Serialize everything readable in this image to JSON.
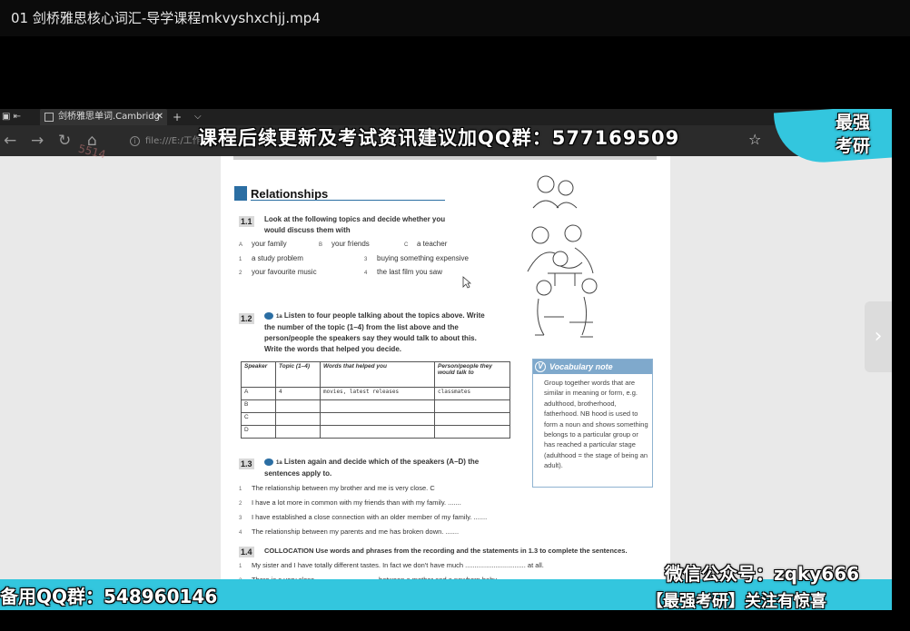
{
  "window": {
    "title": "01 剑桥雅思核心词汇-导学课程mkvyshxchjj.mp4"
  },
  "browser": {
    "tab_title": "剑桥雅思单词.Cambridg",
    "tab_close": "✕",
    "new_tab": "+",
    "tab_menu": "⌵",
    "address": "file:///E:/工作/",
    "watermark": "5514"
  },
  "overlay": {
    "top_banner": "课程后续更新及考试资讯建议加QQ群：577169509",
    "logo": "最强考研",
    "bottom_left": "备用QQ群：548960146",
    "wechat": "微信公众号：zqky666",
    "slogan": "【最强考研】关注有惊喜"
  },
  "page": {
    "section_title": "Relationships",
    "ex11": {
      "num": "1.1",
      "instruction": "Look at the following topics and decide whether you would discuss them with",
      "options_top": [
        {
          "key": "A",
          "text": "your family"
        },
        {
          "key": "B",
          "text": "your friends"
        },
        {
          "key": "C",
          "text": "a teacher"
        }
      ],
      "options": [
        {
          "key": "1",
          "text": "a study problem"
        },
        {
          "key": "3",
          "text": "buying something expensive"
        },
        {
          "key": "2",
          "text": "your favourite music"
        },
        {
          "key": "4",
          "text": "the last film you saw"
        }
      ]
    },
    "ex12": {
      "num": "1.2",
      "track": "1a",
      "instruction": "Listen to four people talking about the topics above. Write the number of the topic (1–4) from the list above and the person/people the speakers say they would talk to about this. Write the words that helped you decide.",
      "table": {
        "headers": [
          "Speaker",
          "Topic (1–4)",
          "Words that helped you",
          "Person/people they would talk to"
        ],
        "rows": [
          [
            "A",
            "4",
            "movies, latest releases",
            "classmates"
          ],
          [
            "B",
            "",
            "",
            ""
          ],
          [
            "C",
            "",
            "",
            ""
          ],
          [
            "D",
            "",
            "",
            ""
          ]
        ]
      }
    },
    "vocab": {
      "title": "Vocabulary note",
      "body": "Group together words that are similar in meaning or form, e.g. adulthood, brotherhood, fatherhood. NB hood is used to form a noun and shows something belongs to a particular group or has reached a particular stage (adulthood = the stage of being an adult)."
    },
    "ex13": {
      "num": "1.3",
      "track": "1a",
      "instruction": "Listen again and decide which of the speakers (A–D) the sentences apply to.",
      "sentences": [
        {
          "key": "1",
          "text": "The relationship between my brother and me is very close. C"
        },
        {
          "key": "2",
          "text": "I have a lot more in common with my friends than with my family. ......."
        },
        {
          "key": "3",
          "text": "I have established a close connection with an older member of my family. ......."
        },
        {
          "key": "4",
          "text": "The relationship between my parents and me has broken down. ......."
        }
      ]
    },
    "ex14": {
      "num": "1.4",
      "instruction": "COLLOCATION Use words and phrases from the recording and the statements in 1.3 to complete the sentences.",
      "sentences": [
        {
          "key": "1",
          "text": "My sister and I have totally different tastes. In fact we don't have much ................................ at all."
        },
        {
          "key": "2",
          "text": "There is a very close ................................ between a mother and a newborn baby."
        }
      ]
    }
  },
  "colors": {
    "accent_cyan": "#33c6de",
    "section_blue": "#2b6ea3",
    "vocab_blue": "#7fa9cc"
  }
}
